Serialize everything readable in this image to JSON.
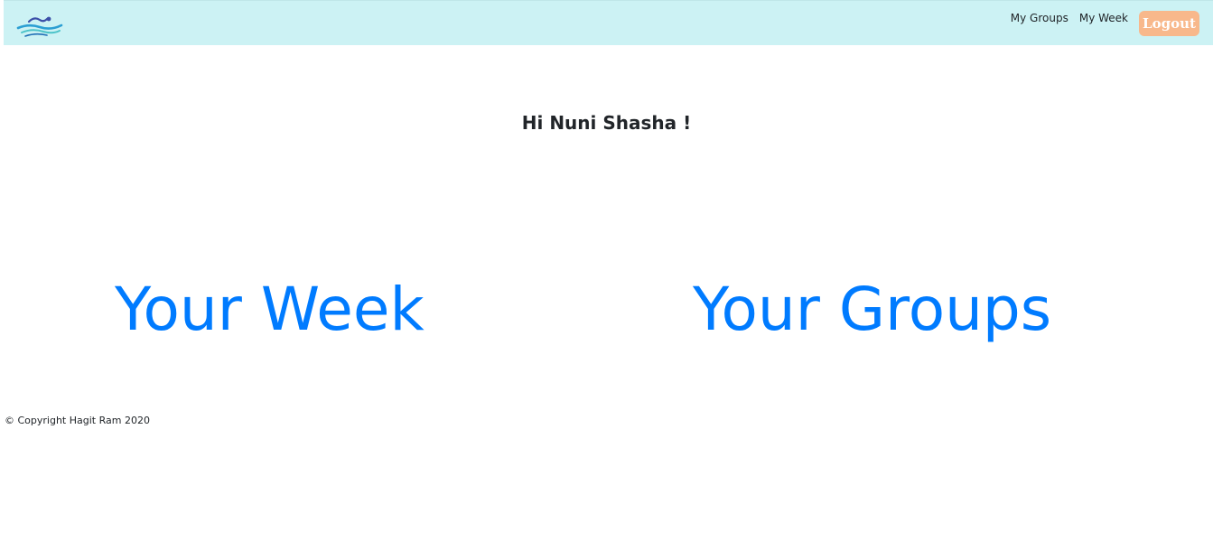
{
  "navbar": {
    "links": [
      {
        "label": "My Groups"
      },
      {
        "label": "My Week"
      }
    ],
    "logout_label": "Logout"
  },
  "main": {
    "greeting": "Hi Nuni Shasha !",
    "your_week_label": "Your Week",
    "your_groups_label": "Your Groups"
  },
  "footer": {
    "copyright": "© Copyright Hagit Ram 2020"
  },
  "colors": {
    "navbar_bg": "#ccf2f4",
    "link_blue": "#007bff",
    "logout_bg": "#f8b88b"
  },
  "icons": {
    "logo": "swimmer-logo-icon"
  }
}
